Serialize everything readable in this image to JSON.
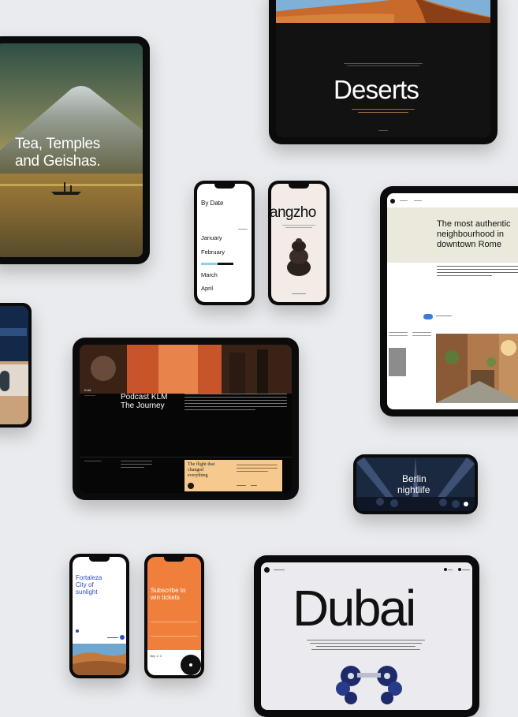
{
  "japan": {
    "title_line1": "Tea, Temples",
    "title_line2": "and Geishas."
  },
  "deserts": {
    "title": "Deserts"
  },
  "bydate": {
    "title": "By Date",
    "months": [
      "January",
      "February",
      "March",
      "April"
    ]
  },
  "hangzhou": {
    "title": "angzho"
  },
  "rome": {
    "title_line1": "The most authentic",
    "title_line2": "neighbourhood in",
    "title_line3": "downtown Rome"
  },
  "klm": {
    "logo": "KLM",
    "title_line1": "Podcast KLM",
    "title_line2": "The Journey",
    "card_line1": "The flight that",
    "card_line2": "changed",
    "card_line3": "everything"
  },
  "berlin": {
    "title_line1": "Berlin",
    "title_line2": "nightlife"
  },
  "fortaleza": {
    "title_line1": "Fortaleza",
    "title_line2": "City of",
    "title_line3": "sunlight"
  },
  "subscribe": {
    "title_line1": "Subscribe to",
    "title_line2": "win tickets",
    "footer": "Step 1 / 3"
  },
  "dubai": {
    "title": "Dubai"
  },
  "colors": {
    "page_bg": "#e9ebee",
    "accent_orange": "#ef7f3a",
    "card_peach": "#f6c98e",
    "device_black": "#0b0b0c",
    "link_blue": "#2a4fc8"
  }
}
